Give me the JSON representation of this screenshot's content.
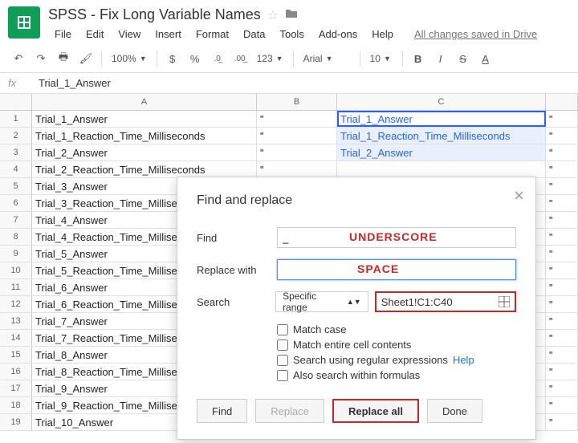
{
  "doc": {
    "title": "SPSS - Fix Long Variable Names",
    "save_status": "All changes saved in Drive"
  },
  "menu": {
    "file": "File",
    "edit": "Edit",
    "view": "View",
    "insert": "Insert",
    "format": "Format",
    "data": "Data",
    "tools": "Tools",
    "addons": "Add-ons",
    "help": "Help"
  },
  "toolbar": {
    "zoom": "100%",
    "fmt123": "123",
    "font": "Arial",
    "size": "10",
    "dollar": "$",
    "percent": "%",
    "dec_less": ".0",
    "dec_more": ".00"
  },
  "formula": {
    "fx": "fx",
    "value": "Trial_1_Answer"
  },
  "cols": {
    "a": "A",
    "b": "B",
    "c": "C"
  },
  "rows": [
    {
      "n": "1",
      "a": "Trial_1_Answer",
      "b": "\"",
      "c": "Trial_1_Answer",
      "d": "\""
    },
    {
      "n": "2",
      "a": "Trial_1_Reaction_Time_Milliseconds",
      "b": "\"",
      "c": "Trial_1_Reaction_Time_Milliseconds",
      "d": "\""
    },
    {
      "n": "3",
      "a": "Trial_2_Answer",
      "b": "\"",
      "c": "Trial_2_Answer",
      "d": "\""
    },
    {
      "n": "4",
      "a": "Trial_2_Reaction_Time_Milliseconds",
      "b": "\"",
      "c": "",
      "d": "\""
    },
    {
      "n": "5",
      "a": "Trial_3_Answer",
      "b": "\"",
      "c": "",
      "d": "\""
    },
    {
      "n": "6",
      "a": "Trial_3_Reaction_Time_Milliseconds",
      "b": "\"",
      "c": "",
      "d": "\""
    },
    {
      "n": "7",
      "a": "Trial_4_Answer",
      "b": "\"",
      "c": "",
      "d": "\""
    },
    {
      "n": "8",
      "a": "Trial_4_Reaction_Time_Milliseconds",
      "b": "\"",
      "c": "",
      "d": "\""
    },
    {
      "n": "9",
      "a": "Trial_5_Answer",
      "b": "\"",
      "c": "",
      "d": "\""
    },
    {
      "n": "10",
      "a": "Trial_5_Reaction_Time_Milliseconds",
      "b": "\"",
      "c": "",
      "d": "\""
    },
    {
      "n": "11",
      "a": "Trial_6_Answer",
      "b": "\"",
      "c": "",
      "d": "\""
    },
    {
      "n": "12",
      "a": "Trial_6_Reaction_Time_Milliseconds",
      "b": "\"",
      "c": "",
      "d": "\""
    },
    {
      "n": "13",
      "a": "Trial_7_Answer",
      "b": "\"",
      "c": "",
      "d": "\""
    },
    {
      "n": "14",
      "a": "Trial_7_Reaction_Time_Milliseconds",
      "b": "\"",
      "c": "",
      "d": "\""
    },
    {
      "n": "15",
      "a": "Trial_8_Answer",
      "b": "\"",
      "c": "",
      "d": "\""
    },
    {
      "n": "16",
      "a": "Trial_8_Reaction_Time_Milliseconds",
      "b": "\"",
      "c": "",
      "d": "\""
    },
    {
      "n": "17",
      "a": "Trial_9_Answer",
      "b": "\"",
      "c": "",
      "d": "\""
    },
    {
      "n": "18",
      "a": "Trial_9_Reaction_Time_Milliseconds",
      "b": "\"",
      "c": "",
      "d": "\""
    },
    {
      "n": "19",
      "a": "Trial_10_Answer",
      "b": "\"",
      "c": "",
      "d": "\""
    }
  ],
  "dialog": {
    "title": "Find and replace",
    "find_label": "Find",
    "find_value": "_",
    "find_annot": "UNDERSCORE",
    "replace_label": "Replace with",
    "replace_value": "",
    "replace_annot": "SPACE",
    "search_label": "Search",
    "scope": "Specific range",
    "range": "Sheet1!C1:C40",
    "match_case": "Match case",
    "match_entire": "Match entire cell contents",
    "regex": "Search using regular expressions",
    "regex_help": "Help",
    "formulas": "Also search within formulas",
    "btn_find": "Find",
    "btn_replace": "Replace",
    "btn_replace_all": "Replace all",
    "btn_done": "Done"
  }
}
